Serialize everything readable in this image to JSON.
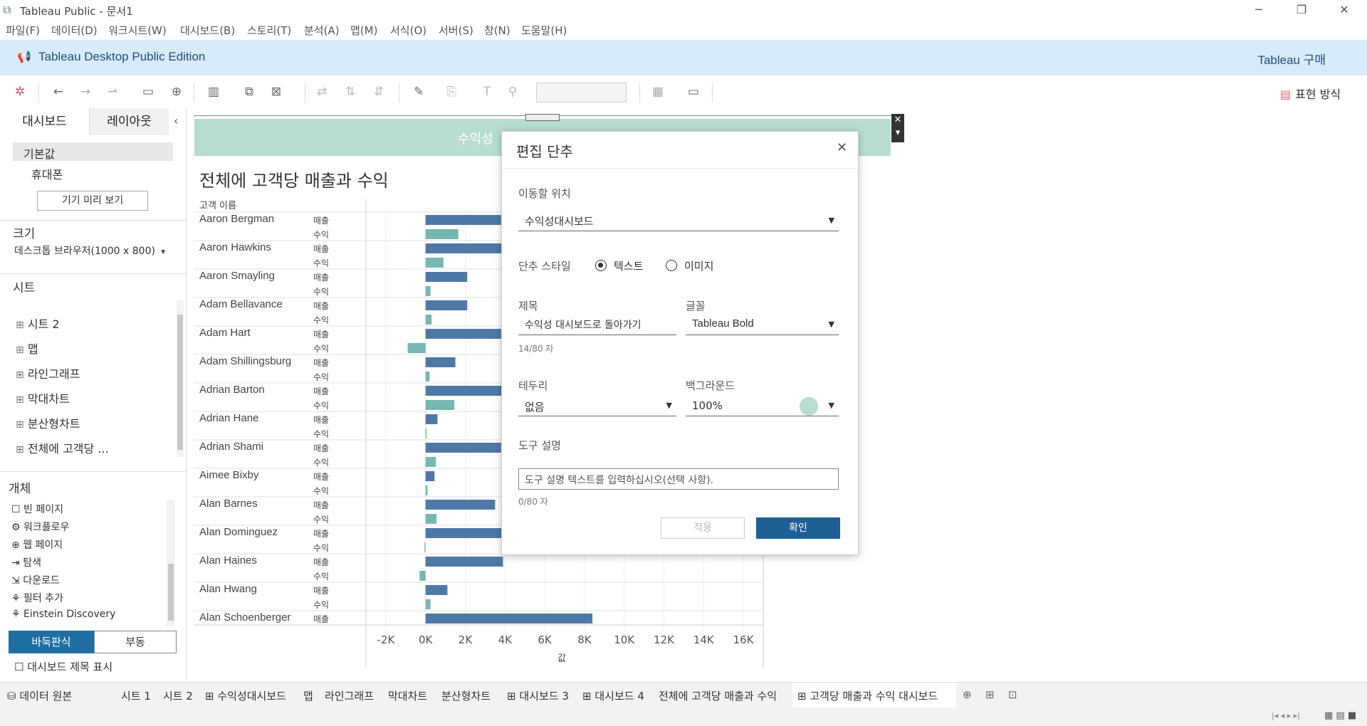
{
  "window": {
    "title": "Tableau Public - 문서1"
  },
  "menu": [
    "파일(F)",
    "데이터(D)",
    "워크시트(W)",
    "대시보드(B)",
    "스토리(T)",
    "분석(A)",
    "맵(M)",
    "서식(O)",
    "서버(S)",
    "창(N)",
    "도움말(H)"
  ],
  "banner": {
    "left": "Tableau Desktop Public Edition",
    "right": "Tableau 구매"
  },
  "toolbar": {
    "show_me": "표현 방식"
  },
  "left_pane": {
    "tabs": [
      "대시보드",
      "레이아웃"
    ],
    "device": {
      "default": "기본값",
      "phone": "휴대폰",
      "preview_button": "기기 미리 보기"
    },
    "size": {
      "heading": "크기",
      "value": "데스크톱 브라우저(1000 x 800)"
    },
    "sheets": {
      "heading": "시트",
      "items": [
        "시트 2",
        "맵",
        "라인그래프",
        "막대차트",
        "분산형차트",
        "전체에 고객당 ..."
      ]
    },
    "objects": {
      "heading": "개체",
      "items": [
        "빈 페이지",
        "워크플로우",
        "웹 페이지",
        "탐색",
        "다운로드",
        "필터 추가",
        "Einstein Discovery"
      ]
    },
    "layout_toggle": {
      "tiled": "바둑판식",
      "floating": "부동"
    },
    "show_title": "대시보드 제목 표시"
  },
  "canvas": {
    "nav_button_text": "수익성",
    "chart_title": "전체에 고객당 매출과 수익",
    "row_header": "고객 이름",
    "x_axis_title": "값"
  },
  "chart_data": {
    "type": "bar",
    "title": "전체에 고객당 매출과 수익",
    "measures": [
      "매출",
      "수익"
    ],
    "colors": {
      "매출": "#4e79a7",
      "수익": "#76b7b2"
    },
    "xlim": [
      -3000,
      17000
    ],
    "xticks": [
      "-2K",
      "0K",
      "2K",
      "4K",
      "6K",
      "8K",
      "10K",
      "12K",
      "14K",
      "16K"
    ],
    "xtick_values": [
      -2000,
      0,
      2000,
      4000,
      6000,
      8000,
      10000,
      12000,
      14000,
      16000
    ],
    "categories": [
      "Aaron Bergman",
      "Aaron Hawkins",
      "Aaron Smayling",
      "Adam Bellavance",
      "Adam Hart",
      "Adam Shillingsburg",
      "Adrian Barton",
      "Adrian Hane",
      "Adrian Shami",
      "Aimee Bixby",
      "Alan Barnes",
      "Alan Dominguez",
      "Alan Haines",
      "Alan Hwang",
      "Alan Schoenberger"
    ],
    "series": [
      {
        "name": "매출",
        "values": [
          3800,
          4000,
          2100,
          2100,
          3800,
          1500,
          4000,
          600,
          3800,
          450,
          3500,
          4000,
          3900,
          1100,
          8400
        ]
      },
      {
        "name": "수익",
        "values": [
          1650,
          900,
          250,
          300,
          -900,
          200,
          1450,
          50,
          520,
          100,
          550,
          -50,
          -300,
          250,
          null
        ]
      }
    ]
  },
  "dialog": {
    "title": "편집 단추",
    "goto_label": "이동할 위치",
    "goto_value": "수익성대시보드",
    "style_label": "단추 스타일",
    "style_text": "텍스트",
    "style_image": "이미지",
    "title_label": "제목",
    "title_value": "수익성 대시보드로 돌아가기",
    "title_count": "14/80 자",
    "font_label": "글꼴",
    "font_value": "Tableau Bold",
    "border_label": "테두리",
    "border_value": "없음",
    "bg_label": "백그라운드",
    "bg_value": "100%",
    "bg_color": "#b7ddd3",
    "tooltip_label": "도구 설명",
    "tooltip_placeholder": "도구 설명 텍스트를 입력하십시오(선택 사항).",
    "tooltip_count": "0/80 자",
    "apply": "적용",
    "ok": "확인"
  },
  "bottom_tabs": [
    "데이터 원본",
    "시트 1",
    "시트 2",
    "수익성대시보드",
    "맵",
    "라인그래프",
    "막대차트",
    "분산형차트",
    "대시보드 3",
    "대시보드 4",
    "전체에 고객당 매출과 수익",
    "고객당 매출과 수익 대시보드"
  ]
}
